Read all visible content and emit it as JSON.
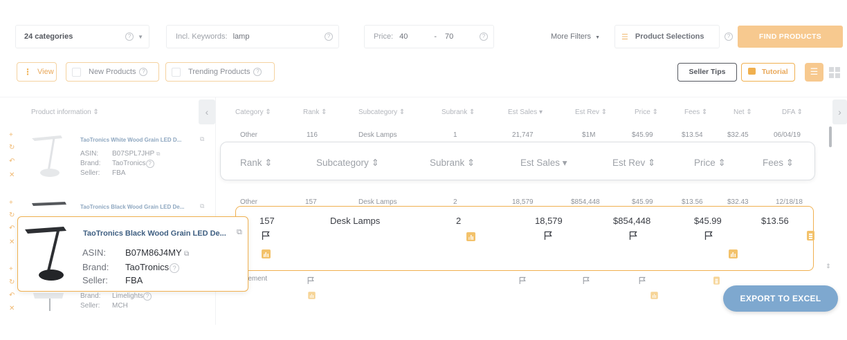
{
  "filters": {
    "categories": "24  categories",
    "keywords_label": "Incl. Keywords:",
    "keywords_value": "lamp",
    "price_label": "Price:",
    "price_min": "40",
    "price_sep": "-",
    "price_max": "70",
    "more_filters": "More Filters",
    "product_selections": "Product Selections",
    "find_products": "FIND PRODUCTS"
  },
  "toolbar": {
    "view": "View",
    "new_products": "New Products",
    "trending_products": "Trending Products",
    "seller_tips": "Seller Tips",
    "tutorial": "Tutorial"
  },
  "table": {
    "headers": {
      "product_info": "Product information",
      "category": "Category",
      "rank": "Rank",
      "subcategory": "Subcategory",
      "subrank": "Subrank",
      "est_sales": "Est Sales",
      "est_rev": "Est Rev",
      "price": "Price",
      "fees": "Fees",
      "net": "Net",
      "dfa": "DFA"
    },
    "rows": [
      {
        "title": "TaoTronics White Wood Grain LED D...",
        "asin_label": "ASIN:",
        "asin": "B07SPL7JHP",
        "brand_label": "Brand:",
        "brand": "TaoTronics",
        "seller_label": "Seller:",
        "seller": "FBA",
        "category": "Other",
        "rank": "116",
        "subcategory": "Desk Lamps",
        "subrank": "1",
        "est_sales": "21,747",
        "est_rev": "$1M",
        "price": "$45.99",
        "fees": "$13.54",
        "net": "$32.45",
        "dfa": "06/04/19"
      },
      {
        "title": "TaoTronics Black Wood Grain LED De...",
        "category": "Other",
        "rank": "157",
        "subcategory": "Desk Lamps",
        "subrank": "2",
        "est_sales": "18,579",
        "est_rev": "$854,448",
        "price": "$45.99",
        "fees": "$13.56",
        "net": "$32.43",
        "dfa": "12/18/18"
      },
      {
        "category": "...ement",
        "brand_label": "Brand:",
        "brand": "Limelights",
        "seller_label": "Seller:",
        "seller": "MCH"
      }
    ]
  },
  "zoom_header": {
    "rank": "Rank",
    "subcategory": "Subcategory",
    "subrank": "Subrank",
    "est_sales": "Est Sales",
    "est_rev": "Est Rev",
    "price": "Price",
    "fees": "Fees"
  },
  "zoom_row": {
    "rank": "157",
    "subcategory": "Desk Lamps",
    "subrank": "2",
    "est_sales": "18,579",
    "est_rev": "$854,448",
    "price": "$45.99",
    "fees": "$13.56"
  },
  "zoom_card": {
    "title": "TaoTronics Black Wood Grain LED De...",
    "asin_label": "ASIN:",
    "asin": "B07M86J4MY",
    "brand_label": "Brand:",
    "brand": "TaoTronics",
    "seller_label": "Seller:",
    "seller": "FBA"
  },
  "export": "EXPORT TO EXCEL",
  "colors": {
    "accent": "#f0b04f",
    "button_orange": "#f7c98f",
    "export_blue": "#7ea8cf",
    "link_blue": "#3f5f82"
  }
}
